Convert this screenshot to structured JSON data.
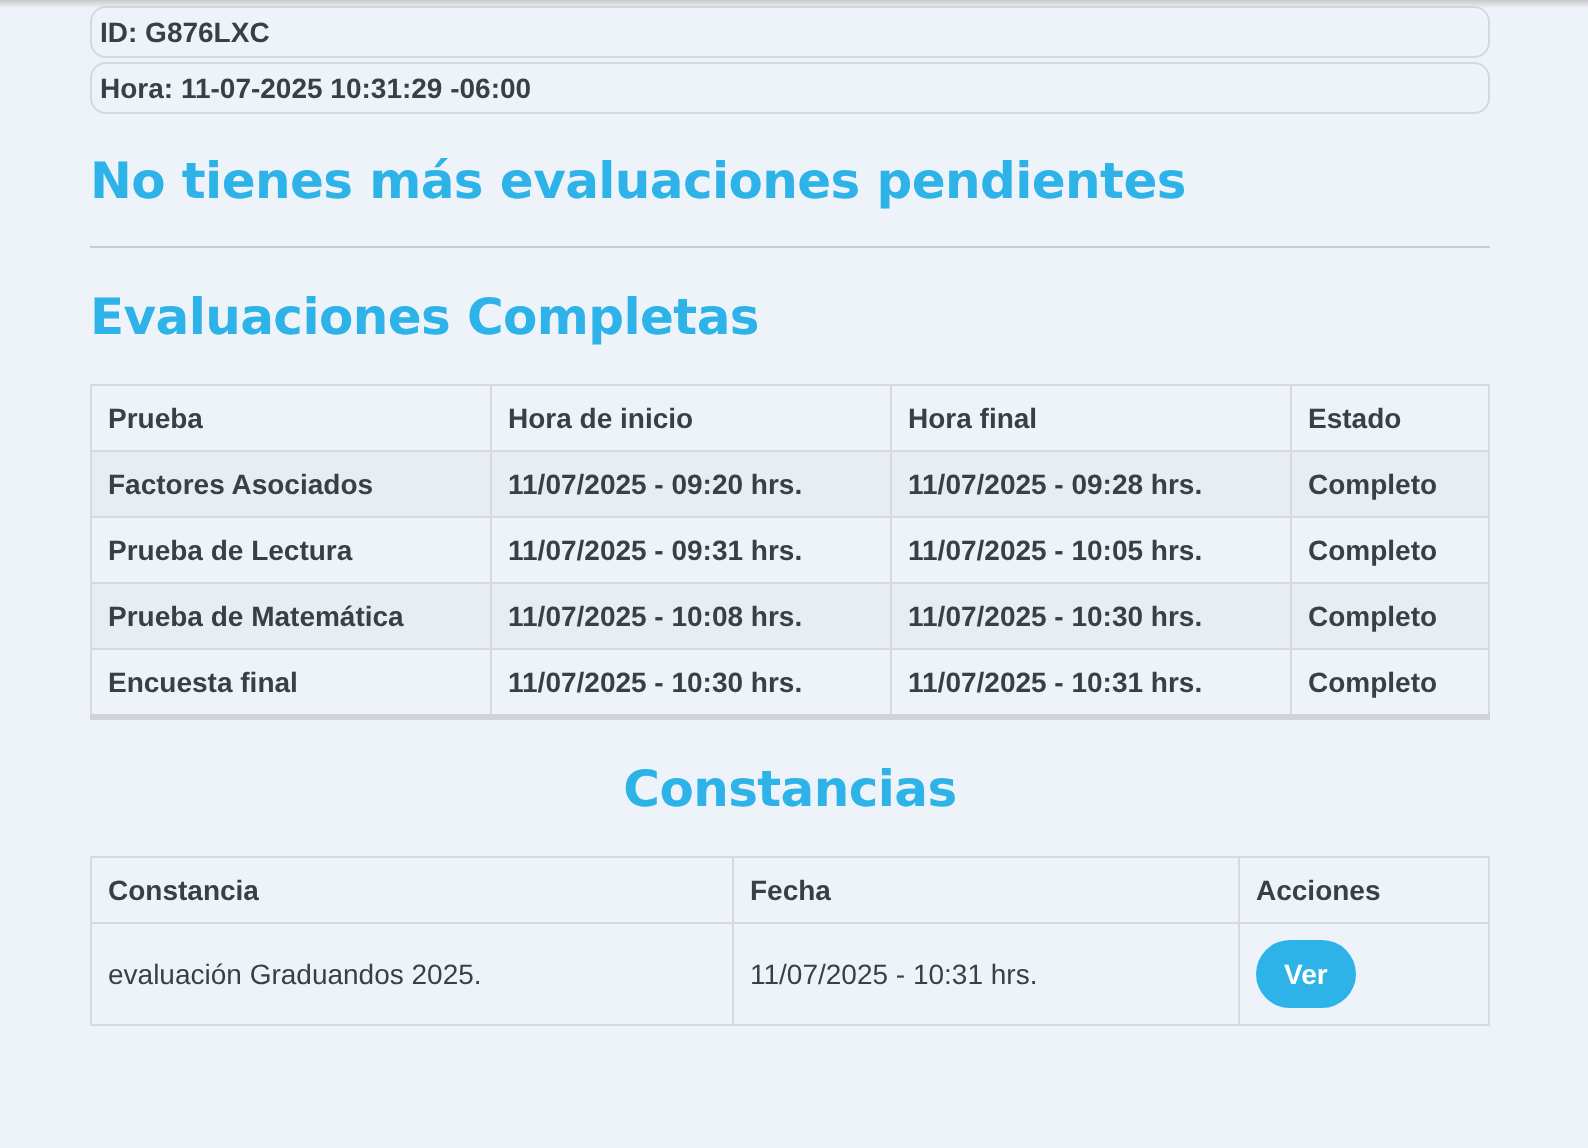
{
  "info": [
    "ID: G876LXC",
    "Hora: 11-07-2025 10:31:29 -06:00"
  ],
  "pending_title": "No tienes más evaluaciones pendientes",
  "completed": {
    "title": "Evaluaciones Completas",
    "columns": [
      "Prueba",
      "Hora de inicio",
      "Hora final",
      "Estado"
    ],
    "rows": [
      [
        "Factores Asociados",
        "11/07/2025 - 09:20 hrs.",
        "11/07/2025 - 09:28 hrs.",
        "Completo"
      ],
      [
        "Prueba de Lectura",
        "11/07/2025 - 09:31 hrs.",
        "11/07/2025 - 10:05 hrs.",
        "Completo"
      ],
      [
        "Prueba de Matemática",
        "11/07/2025 - 10:08 hrs.",
        "11/07/2025 - 10:30 hrs.",
        "Completo"
      ],
      [
        "Encuesta final",
        "11/07/2025 - 10:30 hrs.",
        "11/07/2025 - 10:31 hrs.",
        "Completo"
      ]
    ]
  },
  "certificates": {
    "title": "Constancias",
    "columns": [
      "Constancia",
      "Fecha",
      "Acciones"
    ],
    "rows": [
      {
        "name": "evaluación Graduandos 2025.",
        "date": "11/07/2025 - 10:31 hrs.",
        "action": "Ver"
      }
    ]
  }
}
